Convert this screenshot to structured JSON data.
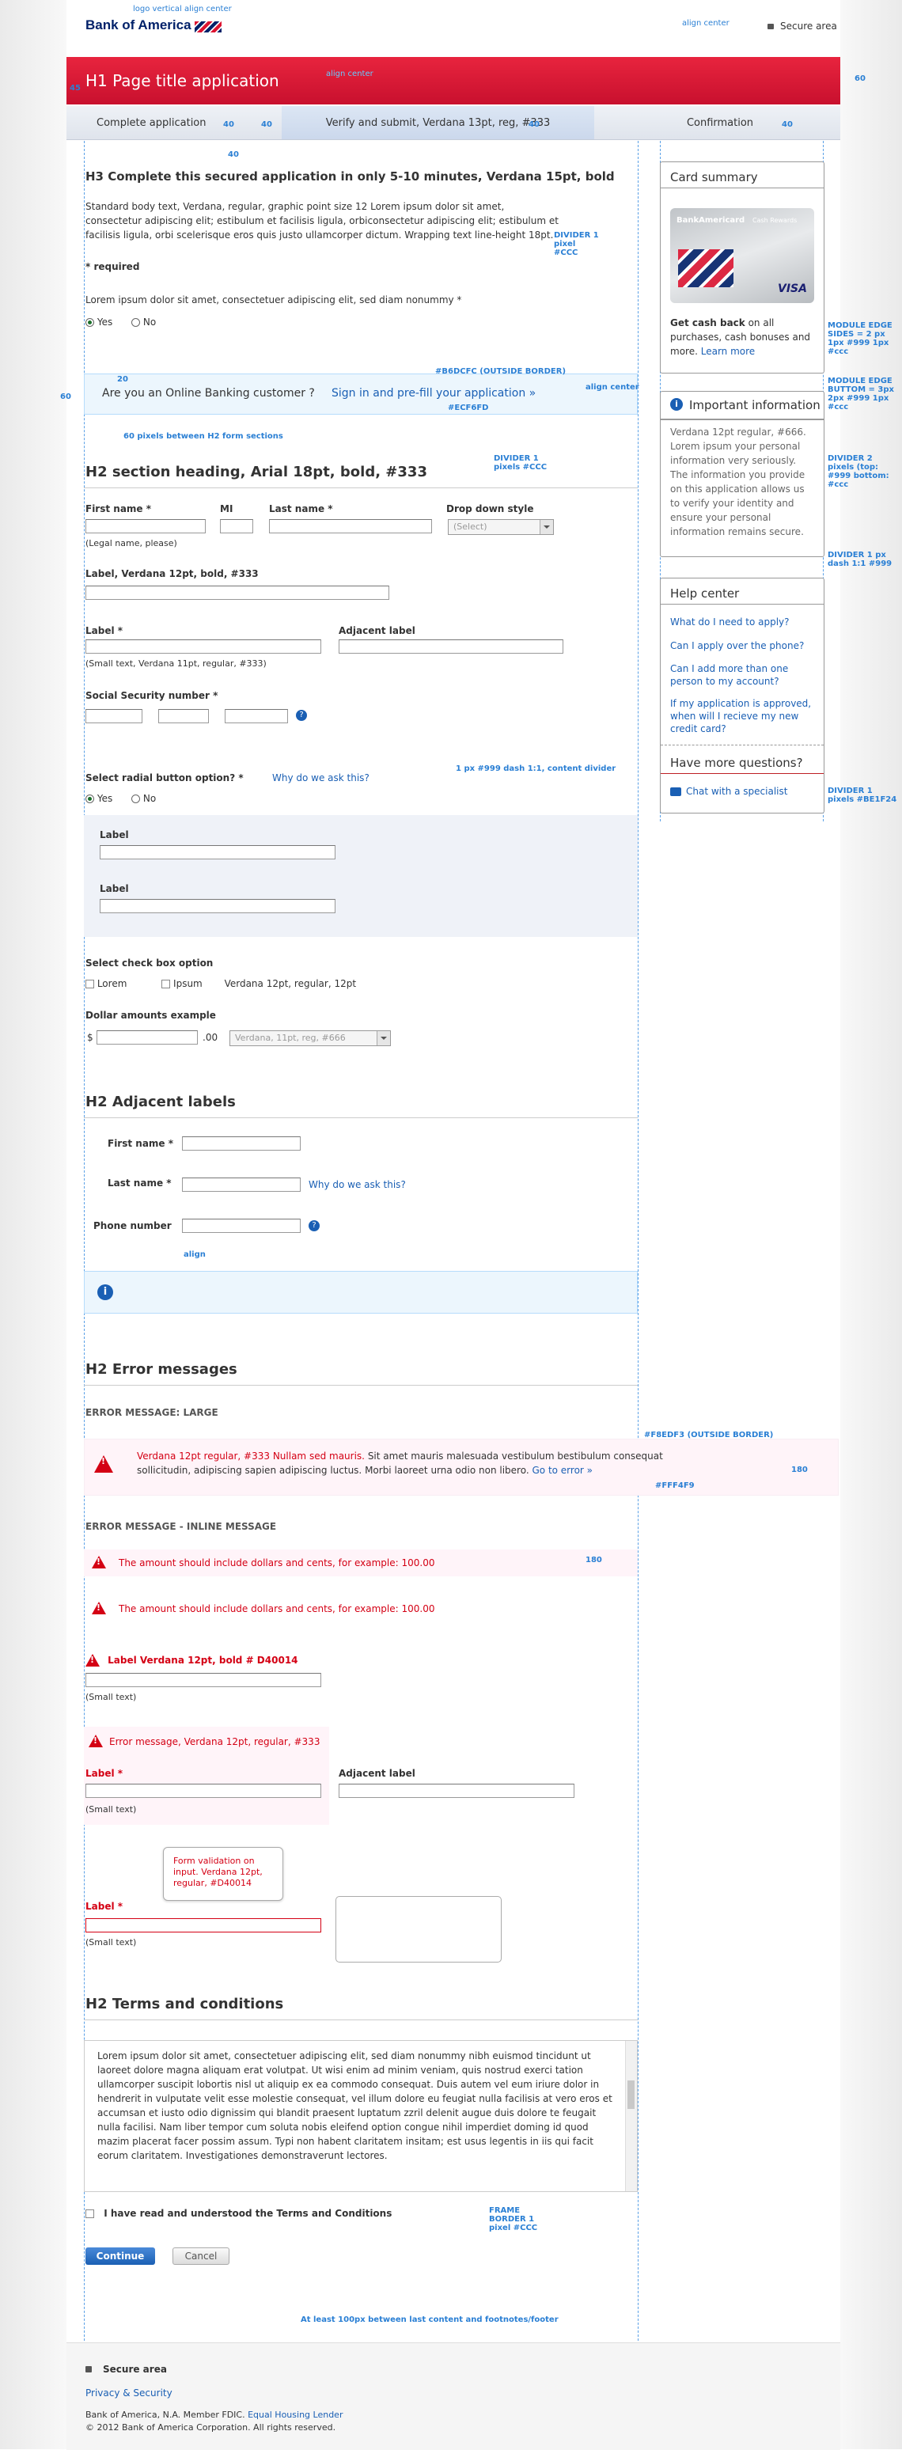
{
  "header": {
    "logo_text": "Bank of America",
    "logo_note": "logo vertical align center",
    "align_note": "align center",
    "secure": "Secure area",
    "title": "H1 Page title application",
    "title_note": "align center",
    "spec_60": "60",
    "spec_45": "45"
  },
  "steps": [
    "Complete application",
    "Verify and submit, Verdana 13pt, reg, #333",
    "Confirmation"
  ],
  "steps_spec": [
    "40",
    "40",
    "40",
    "40",
    "40"
  ],
  "intro": {
    "h3": "H3 Complete this secured application in only 5-10 minutes, Verdana 15pt, bold",
    "body": "Standard body text, Verdana, regular, graphic point size 12 Lorem ipsum dolor sit amet, consectetur adipiscing elit; estibulum et facilisis ligula, orbiconsectetur adipiscing elit; estibulum et facilisis ligula, orbi scelerisque eros quis justo ullamcorper dictum. Wrapping text line-height 18pt.",
    "required": "* required",
    "question": "Lorem ipsum dolor sit amet, consectetuer adipiscing elit, sed diam nonummy *",
    "yes": "Yes",
    "no": "No",
    "divider_note": "DIVIDER 1 pixel #CCC"
  },
  "banner": {
    "text": "Are you an Online Banking customer ?",
    "link": "Sign in and pre-fill your application »",
    "note_border": "#B6DCFC (OUTSIDE BORDER)",
    "note_bg": "#ECF6FD",
    "align": "align center",
    "note_60": "60 pixels between H2 form sections",
    "s60": "60",
    "s20": "20"
  },
  "form1": {
    "h2": "H2 section heading, Arial 18pt, bold, #333",
    "divider": "DIVIDER 1 pixels #CCC",
    "first": "First name *",
    "mi": "MI",
    "last": "Last name *",
    "dropdown": "Drop down style",
    "select": "(Select)",
    "legal": "(Legal name, please)",
    "label12": "Label, Verdana 12pt, bold, #333",
    "label": "Label *",
    "adjacent": "Adjacent label",
    "small": "(Small text, Verdana 11pt, regular, #333)",
    "ssn": "Social Security number *",
    "radial": "Select radial button option? *",
    "why": "Why do we ask this?",
    "yes": "Yes",
    "no": "No",
    "content_divider": "1 px #999 dash 1:1, content divider",
    "sub_label": "Label",
    "checkbox_q": "Select check box option",
    "cb": [
      "Lorem",
      "Ipsum",
      "Verdana 12pt, regular, 12pt"
    ],
    "dollar": "Dollar amounts example",
    "dollar_sign": "$",
    "cents": ".00",
    "select2": "Verdana, 11pt, reg, #666"
  },
  "adjacent": {
    "h2": "H2 Adjacent labels",
    "first": "First name *",
    "last": "Last name *",
    "phone": "Phone number",
    "why": "Why do we ask this?",
    "align": "align"
  },
  "errors": {
    "h2": "H2 Error messages",
    "large_title": "ERROR MESSAGE: LARGE",
    "large_red": "Verdana 12pt regular, #333 Nullam sed mauris.",
    "large_text": " Sit amet mauris malesuada vestibulum bestibulum consequat sollicitudin, adipiscing sapien adipiscing luctus. Morbi laoreet urna odio non libero.",
    "large_link": "Go to error »",
    "note_border": "#F8EDF3 (OUTSIDE BORDER)",
    "note_bg": "#FFF4F9",
    "inline_title": "ERROR MESSAGE - INLINE MESSAGE",
    "inline1": "The amount should include dollars and cents, for example: 100.00",
    "inline2": "The amount should include dollars and cents, for example: 100.00",
    "bold_label": "Label Verdana 12pt, bold # D40014",
    "small": "(Small text)",
    "err_msg": "Error message, Verdana 12pt, regular, #333",
    "label": "Label *",
    "adjacent": "Adjacent label",
    "small2": "(Small text)",
    "tooltip": "Form validation on input. Verdana 12pt, regular, #D40014",
    "label3": "Label *",
    "small3": "(Small text)",
    "s180": "180"
  },
  "terms": {
    "h2": "H2 Terms and conditions",
    "text": "Lorem ipsum dolor sit amet, consectetuer adipiscing elit, sed diam nonummy nibh euismod tincidunt ut laoreet dolore magna aliquam erat volutpat. Ut wisi enim ad minim veniam, quis nostrud exerci tation ullamcorper suscipit lobortis nisl ut aliquip ex ea commodo consequat. Duis autem vel eum iriure dolor in hendrerit in vulputate velit esse molestie consequat, vel illum dolore eu feugiat nulla facilisis at vero eros et accumsan et iusto odio dignissim qui blandit praesent luptatum zzril delenit augue duis dolore te feugait nulla facilisi. Nam liber tempor cum soluta nobis eleifend option congue nihil imperdiet doming id quod mazim placerat facer possim assum. Typi non habent claritatem insitam; est usus legentis in iis qui facit eorum claritatem. Investigationes demonstraverunt lectores.",
    "agree": "I have read and understood the Terms and Conditions",
    "frame_note": "FRAME BORDER 1 pixel #CCC",
    "continue": "Continue",
    "cancel": "Cancel",
    "note_footer": "At least 100px between last content and footnotes/footer"
  },
  "sidebar": {
    "card_title": "Card summary",
    "card_brand": "BankAmericard",
    "card_sub": "Cash Rewards",
    "card_visa": "VISA",
    "cash_bold": "Get cash back",
    "cash_text": " on all purchases, cash bonuses and more.",
    "learn": "Learn more",
    "module_edge": "MODULE EDGE SIDES = 2 px 1px #999 1px #ccc",
    "module_bottom": "MODULE EDGE BUTTOM = 3px 2px #999 1px #ccc",
    "info_title": "Important information",
    "info_text": "Verdana 12pt regular, #666. Lorem ipsum your personal information very seriously. The information you provide on this application allows us to verify your identity and ensure your personal information remains secure.",
    "divider1": "DIVIDER 2 pixels (top: #999 bottom: #ccc",
    "divider2": "DIVIDER 1 px dash 1:1 #999",
    "help_title": "Help center",
    "help_links": [
      "What do I need to apply?",
      "Can I apply over the phone?",
      "Can I add more than one person to my account?",
      "If my application is approved, when will I recieve my new credit card?"
    ],
    "questions": "Have more questions?",
    "chat": "Chat with a specialist",
    "divider3": "DIVIDER 1 pixels #BE1F24"
  },
  "footer": {
    "secure": "Secure area",
    "privacy": "Privacy & Security",
    "line1": "Bank of America, N.A. Member FDIC.",
    "ehl": "Equal Housing Lender",
    "line2": "© 2012 Bank of America Corporation. All rights reserved."
  },
  "colors": {
    "red": "#D40014",
    "header_red": "#DC1431",
    "blue_link": "#1A5FB4",
    "spec_blue": "#2A7FD4"
  }
}
